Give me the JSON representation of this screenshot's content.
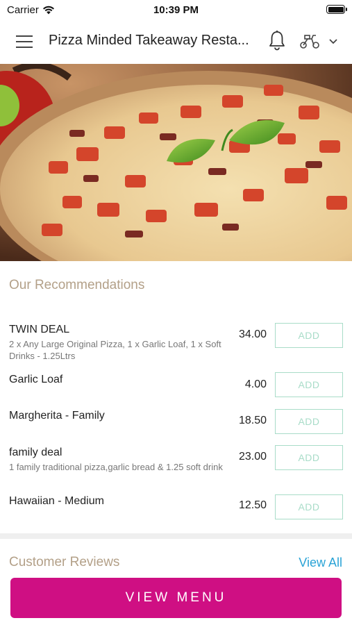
{
  "status_bar": {
    "carrier": "Carrier",
    "time": "10:39 PM"
  },
  "header": {
    "title": "Pizza Minded Takeaway Resta...",
    "icons": [
      "menu-icon",
      "bell-icon",
      "delivery-scooter-icon",
      "chevron-down-icon"
    ]
  },
  "hero": {
    "image": "pizza-with-basil-photo"
  },
  "recommendations": {
    "title": "Our Recommendations",
    "items": [
      {
        "name": "TWIN DEAL",
        "description": "2 x Any Large Original Pizza, 1 x Garlic Loaf, 1 x Soft Drinks - 1.25Ltrs",
        "price": "34.00",
        "action": "ADD"
      },
      {
        "name": "Garlic Loaf",
        "description": "",
        "price": "4.00",
        "action": "ADD"
      },
      {
        "name": "Margherita - Family",
        "description": "",
        "price": "18.50",
        "action": "ADD"
      },
      {
        "name": "family deal",
        "description": "1 family traditional pizza,garlic bread & 1.25 soft drink",
        "price": "23.00",
        "action": "ADD"
      },
      {
        "name": "Hawaiian - Medium",
        "description": "",
        "price": "12.50",
        "action": "ADD"
      }
    ]
  },
  "reviews": {
    "title": "Customer Reviews",
    "view_all": "View All"
  },
  "footer": {
    "view_menu": "VIEW MENU"
  },
  "colors": {
    "accent": "#cf0f83",
    "link": "#2aa3d6",
    "section_title": "#b3a088",
    "add_border": "#a8dcc8"
  }
}
